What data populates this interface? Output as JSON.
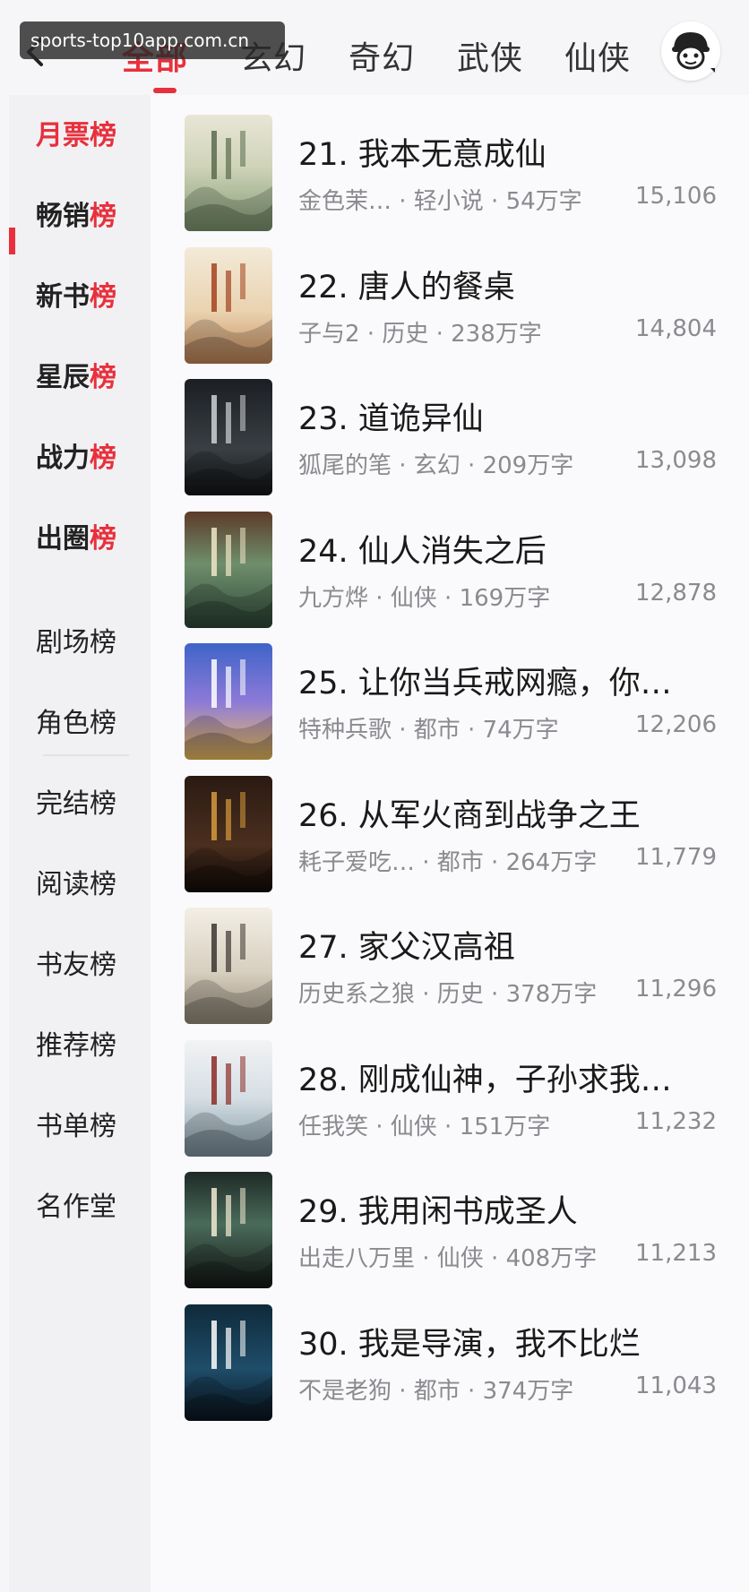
{
  "header": {
    "tabs": [
      "全部",
      "玄幻",
      "奇幻",
      "武侠",
      "仙侠"
    ],
    "active_tab": "全部",
    "watermark": "sports-top10app.com.cn"
  },
  "sidebar": {
    "hot_items": [
      {
        "main": "月票",
        "last": "榜"
      },
      {
        "main": "畅销",
        "last": "榜"
      },
      {
        "main": "新书",
        "last": "榜"
      },
      {
        "main": "星辰",
        "last": "榜"
      },
      {
        "main": "战力",
        "last": "榜"
      },
      {
        "main": "出圈",
        "last": "榜"
      }
    ],
    "items": [
      "剧场榜",
      "角色榜",
      "完结榜",
      "阅读榜",
      "书友榜",
      "推荐榜",
      "书单榜",
      "名作堂"
    ]
  },
  "books": [
    {
      "title": "21. 我本无意成仙",
      "meta": "金色茉…  · 轻小说 · 54万字",
      "count": "15,106"
    },
    {
      "title": "22. 唐人的餐桌",
      "meta": "子与2 · 历史 · 238万字",
      "count": "14,804"
    },
    {
      "title": "23. 道诡异仙",
      "meta": "狐尾的笔 · 玄幻 · 209万字",
      "count": "13,098"
    },
    {
      "title": "24. 仙人消失之后",
      "meta": "九方烨 · 仙侠 · 169万字",
      "count": "12,878"
    },
    {
      "title": "25. 让你当兵戒网瘾，你…",
      "meta": "特种兵歌 · 都市 · 74万字",
      "count": "12,206"
    },
    {
      "title": "26. 从军火商到战争之王",
      "meta": "耗子爱吃…  · 都市 · 264万字",
      "count": "11,779"
    },
    {
      "title": "27. 家父汉高祖",
      "meta": "历史系之狼 · 历史 · 378万字",
      "count": "11,296"
    },
    {
      "title": "28. 刚成仙神，子孙求我…",
      "meta": "任我笑 · 仙侠 · 151万字",
      "count": "11,232"
    },
    {
      "title": "29. 我用闲书成圣人",
      "meta": "出走八万里 · 仙侠 · 408万字",
      "count": "11,213"
    },
    {
      "title": "30. 我是导演，我不比烂",
      "meta": "不是老狗 · 都市 · 374万字",
      "count": "11,043"
    }
  ],
  "colors": {
    "accent": "#e8303c",
    "meta_text": "#8a8a8f"
  }
}
